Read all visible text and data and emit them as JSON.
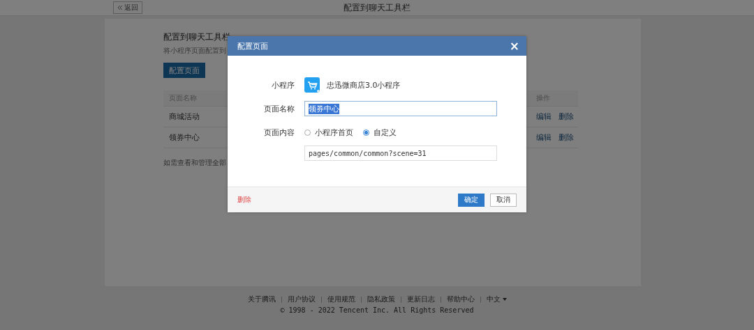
{
  "topbar": {
    "back": "返回",
    "title": "配置到聊天工具栏"
  },
  "section": {
    "title": "配置到聊天工具栏",
    "subtitle": "将小程序页面配置到",
    "button": "配置页面"
  },
  "table": {
    "columns": [
      "页面名称",
      "操作"
    ],
    "rows": [
      {
        "name": "商城活动",
        "actions": [
          "编辑",
          "删除"
        ]
      },
      {
        "name": "领券中心",
        "actions": [
          "编辑",
          "删除"
        ]
      }
    ]
  },
  "note": "如需查看和管理全部",
  "footer": {
    "links": [
      "关于腾讯",
      "用户协议",
      "使用规范",
      "隐私政策",
      "更新日志",
      "帮助中心",
      "中文"
    ],
    "copyright": "© 1998 - 2022 Tencent Inc. All Rights Reserved"
  },
  "dialog": {
    "title": "配置页面",
    "close": "×",
    "fields": [
      {
        "kind": "app",
        "label": "小程序",
        "value": "忠迅微商店3.0小程序"
      },
      {
        "kind": "input",
        "label": "页面名称",
        "value": "领券中心",
        "text_selected": true
      },
      {
        "kind": "radio",
        "label": "页面内容",
        "options": [
          {
            "label": "小程序首页",
            "selected": false
          },
          {
            "label": "自定义",
            "selected": true
          }
        ],
        "value": "pages/common/common?scene=31"
      }
    ],
    "delete": "删除",
    "ok": "确定",
    "cancel": "取消"
  }
}
